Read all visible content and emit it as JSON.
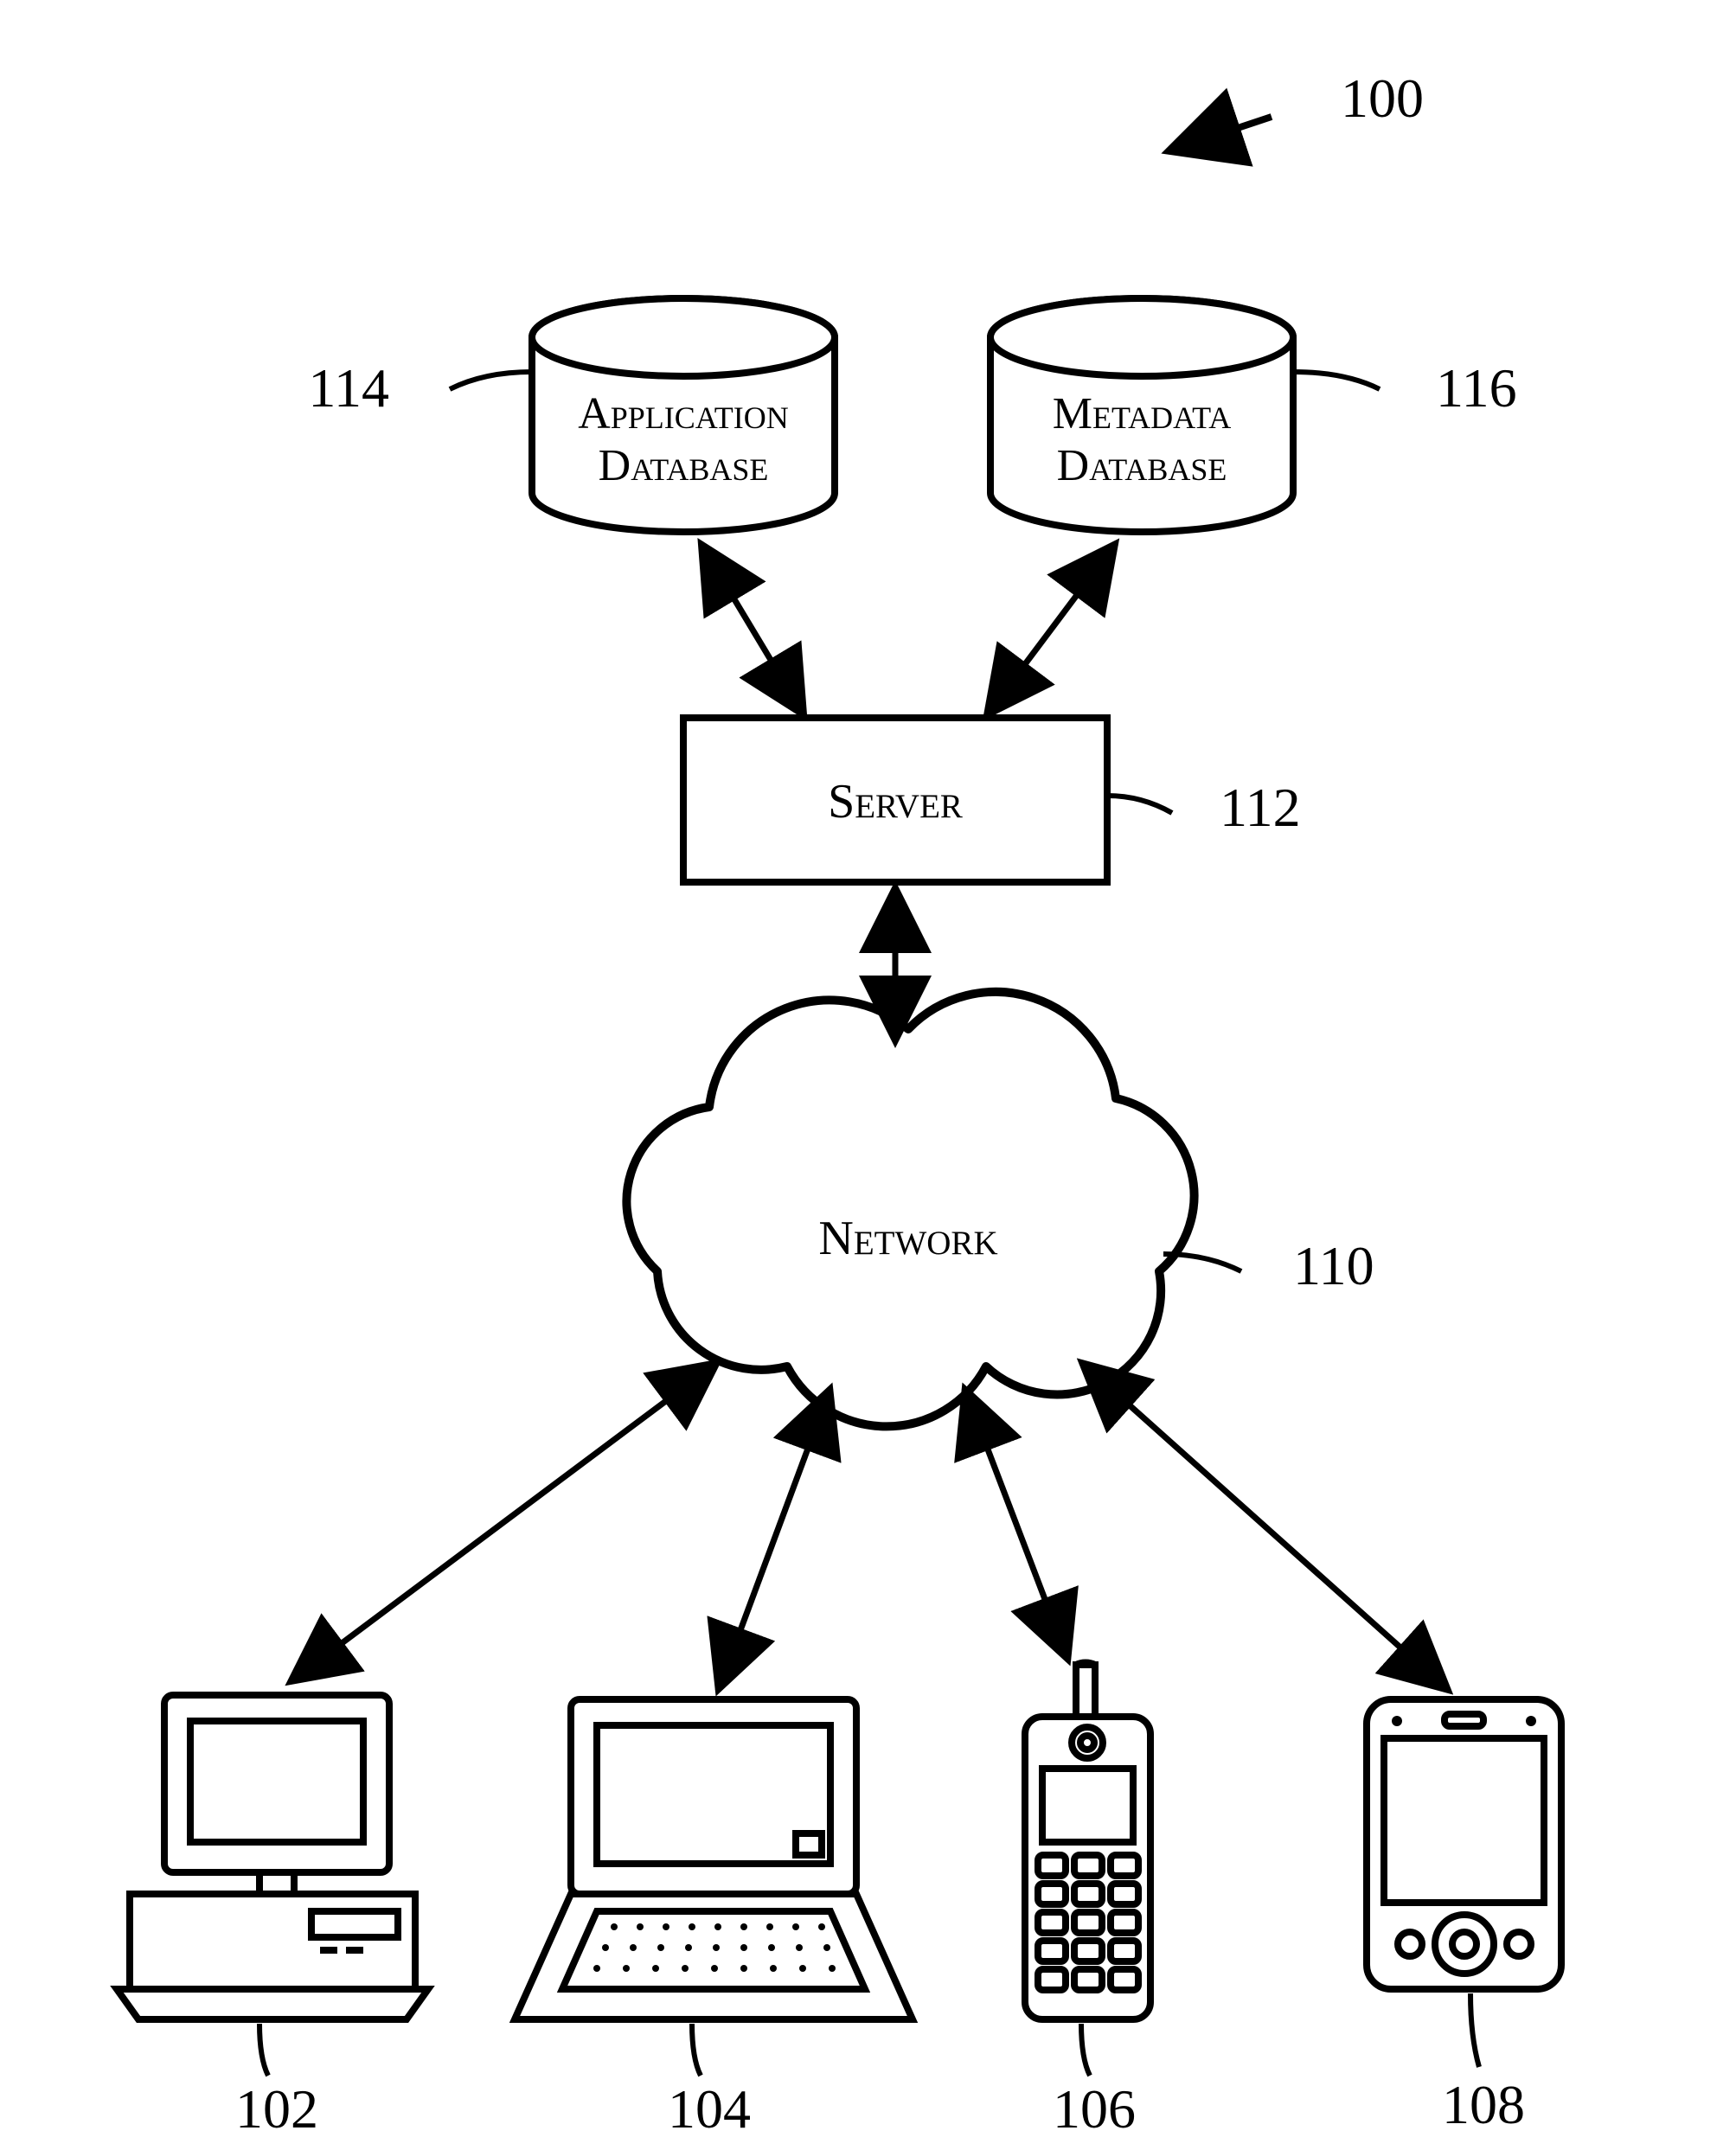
{
  "figure": {
    "ref_main": "100",
    "db1": {
      "line1": "Application",
      "line2": "Database",
      "ref": "114"
    },
    "db2": {
      "line1": "Metadata",
      "line2": "Database",
      "ref": "116"
    },
    "server": {
      "label": "Server",
      "ref": "112"
    },
    "network": {
      "label": "Network",
      "ref": "110"
    },
    "clients": {
      "desktop": {
        "ref": "102"
      },
      "laptop": {
        "ref": "104"
      },
      "phone": {
        "ref": "106"
      },
      "pda": {
        "ref": "108"
      }
    }
  }
}
